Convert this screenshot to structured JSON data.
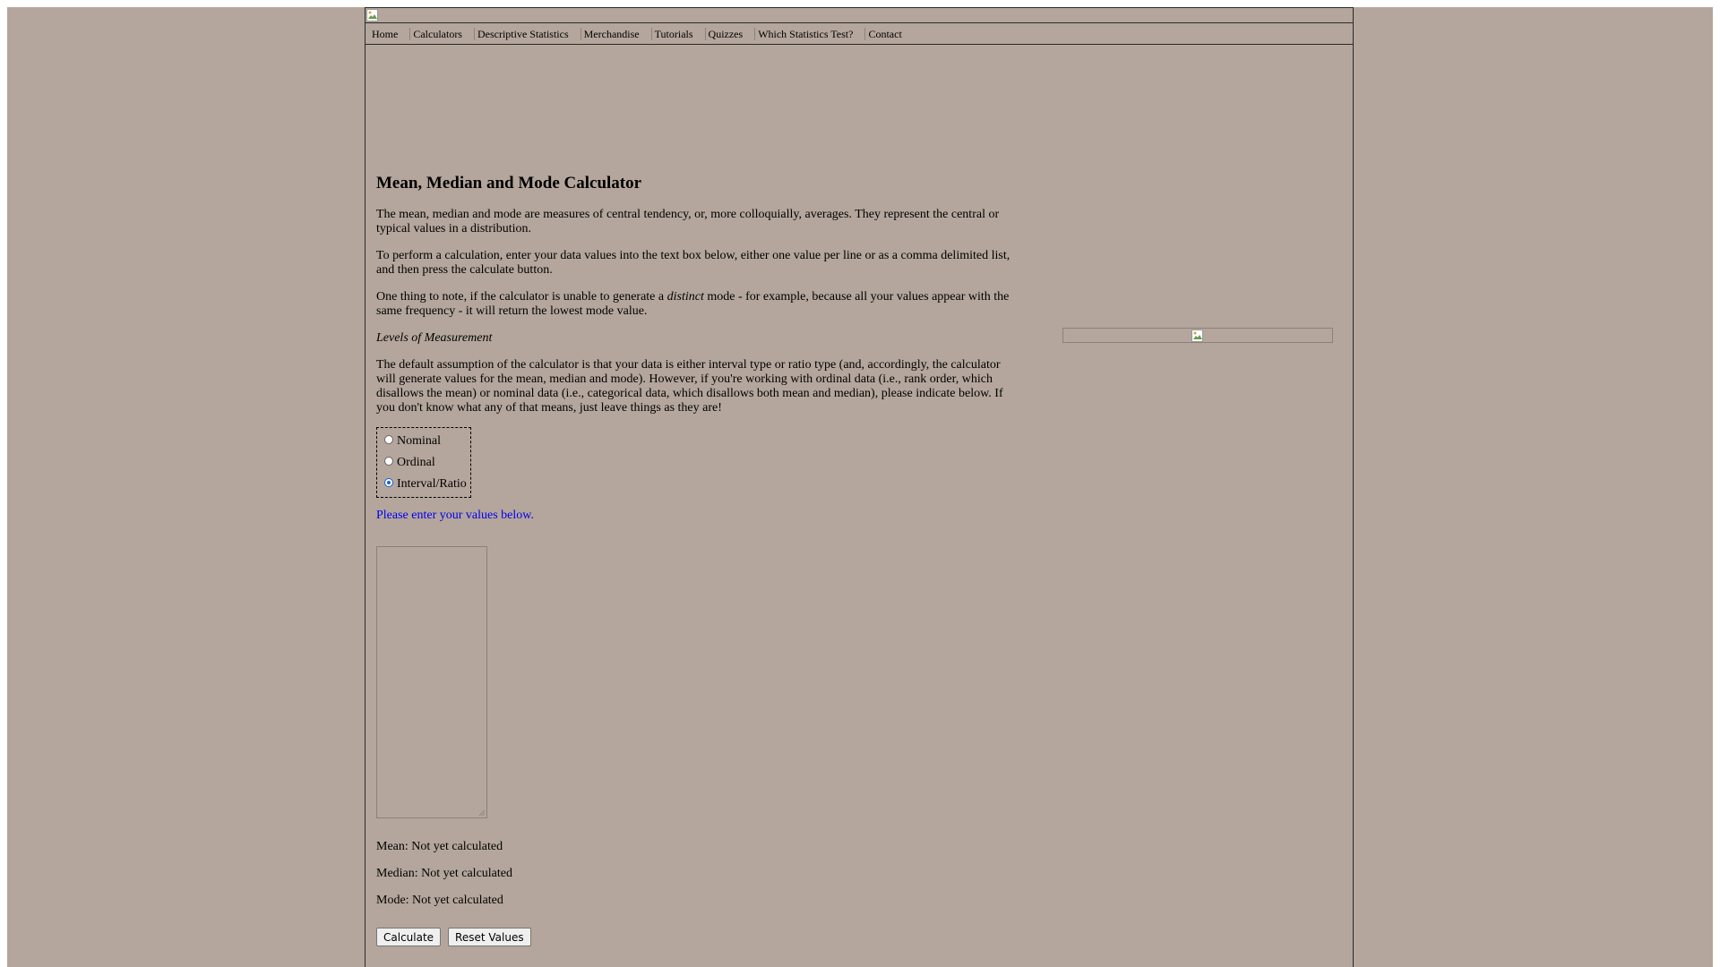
{
  "nav": {
    "items": [
      "Home",
      "Calculators",
      "Descriptive Statistics",
      "Merchandise",
      "Tutorials",
      "Quizzes",
      "Which Statistics Test?",
      "Contact"
    ]
  },
  "main": {
    "title": "Mean, Median and Mode Calculator",
    "intro": "The mean, median and mode are measures of central tendency, or, more colloquially, averages. They represent the central or typical values in a distribution.",
    "instructions": "To perform a calculation, enter your data values into the text box below, either one value per line or as a comma delimited list, and then press the calculate button.",
    "note_before": "One thing to note, if the calculator is unable to generate a ",
    "note_italic": "distinct",
    "note_after": " mode - for example, because all your values appear with the same frequency - it will return the lowest mode value.",
    "levels_heading": "Levels of Measurement",
    "levels_text": "The default assumption of the calculator is that your data is either interval type or ratio type (and, accordingly, the calculator will generate values for the mean, median and mode). However, if you're working with ordinal data (i.e., rank order, which disallows the mean) or nominal data (i.e., categorical data, which disallows both mean and median), please indicate below. If you don't know what any of that means, just leave things as they are!",
    "levels": [
      {
        "label": "Nominal",
        "checked": false
      },
      {
        "label": "Ordinal",
        "checked": false
      },
      {
        "label": "Interval/Ratio",
        "checked": true
      }
    ],
    "prompt": "Please enter your values below.",
    "values_input": "",
    "results": {
      "mean": "Mean: Not yet calculated",
      "median": "Median: Not yet calculated",
      "mode": "Mode: Not yet calculated"
    },
    "calculate_label": "Calculate",
    "reset_label": "Reset Values"
  },
  "colors": {
    "background": "#b4a69c",
    "prompt": "#0000ee",
    "radio_checked": "#1a5fd6"
  },
  "icons": {
    "banner": "broken-image-icon",
    "ad": "broken-image-icon"
  }
}
